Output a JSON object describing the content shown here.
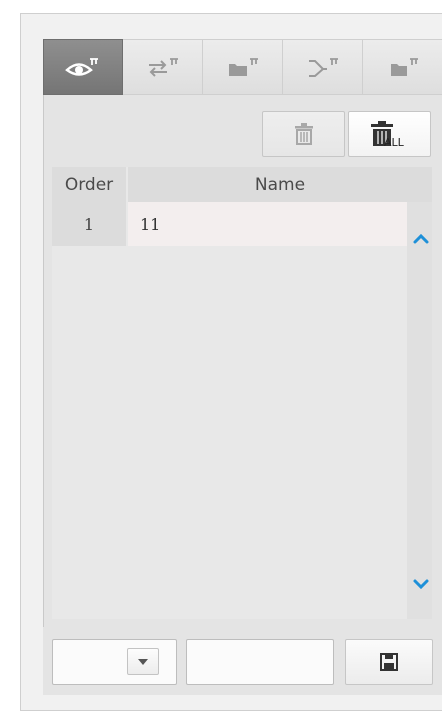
{
  "tabs": [
    {
      "icon": "eye-icon",
      "active": true
    },
    {
      "icon": "swap-arrows-icon",
      "active": false
    },
    {
      "icon": "folder-icon",
      "active": false
    },
    {
      "icon": "share-tree-icon",
      "active": false
    },
    {
      "icon": "folder-open-icon",
      "active": false
    }
  ],
  "toolbar": {
    "delete_icon": "trash-icon",
    "delete_all_icon": "trash-all-icon",
    "delete_all_label": "ALL"
  },
  "table": {
    "columns": [
      "Order",
      "Name"
    ],
    "rows": [
      {
        "order": "1",
        "name": "11"
      }
    ]
  },
  "scroll": {
    "up_icon": "chevron-up-icon",
    "down_icon": "chevron-down-icon"
  },
  "footer": {
    "select_value": "",
    "input_value": "",
    "input_placeholder": "",
    "save_icon": "save-icon"
  },
  "colors": {
    "active_tab": "#7f7f7f",
    "scroll_arrow": "#1e90d8",
    "panel": "#e4e4e4"
  }
}
